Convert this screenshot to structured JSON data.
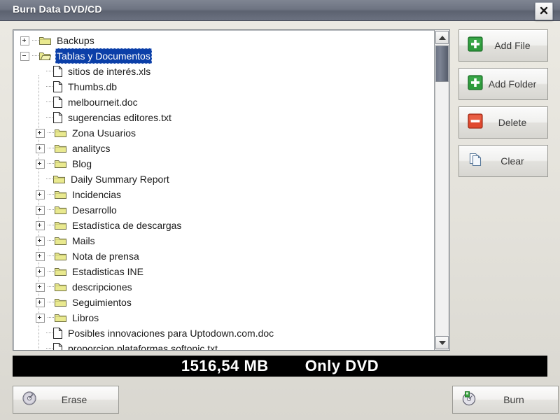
{
  "window": {
    "title": "Burn Data DVD/CD",
    "close_icon": "close-icon"
  },
  "tree": {
    "items": [
      {
        "label": "Backups",
        "type": "folder",
        "depth": 0,
        "toggle": "plus",
        "selected": false
      },
      {
        "label": "Tablas y Documentos",
        "type": "folder-open",
        "depth": 0,
        "toggle": "minus",
        "selected": true
      },
      {
        "label": "sitios de interés.xls",
        "type": "file",
        "depth": 1,
        "toggle": "none",
        "selected": false
      },
      {
        "label": "Thumbs.db",
        "type": "file",
        "depth": 1,
        "toggle": "none",
        "selected": false
      },
      {
        "label": "melbourneit.doc",
        "type": "file",
        "depth": 1,
        "toggle": "none",
        "selected": false
      },
      {
        "label": "sugerencias editores.txt",
        "type": "file",
        "depth": 1,
        "toggle": "none",
        "selected": false
      },
      {
        "label": "Zona Usuarios",
        "type": "folder",
        "depth": 1,
        "toggle": "plus",
        "selected": false
      },
      {
        "label": "analitycs",
        "type": "folder",
        "depth": 1,
        "toggle": "plus",
        "selected": false
      },
      {
        "label": "Blog",
        "type": "folder",
        "depth": 1,
        "toggle": "plus",
        "selected": false
      },
      {
        "label": "Daily Summary Report",
        "type": "folder",
        "depth": 1,
        "toggle": "none",
        "selected": false
      },
      {
        "label": "Incidencias",
        "type": "folder",
        "depth": 1,
        "toggle": "plus",
        "selected": false
      },
      {
        "label": "Desarrollo",
        "type": "folder",
        "depth": 1,
        "toggle": "plus",
        "selected": false
      },
      {
        "label": "Estadística de descargas",
        "type": "folder",
        "depth": 1,
        "toggle": "plus",
        "selected": false
      },
      {
        "label": "Mails",
        "type": "folder",
        "depth": 1,
        "toggle": "plus",
        "selected": false
      },
      {
        "label": "Nota de prensa",
        "type": "folder",
        "depth": 1,
        "toggle": "plus",
        "selected": false
      },
      {
        "label": "Estadisticas INE",
        "type": "folder",
        "depth": 1,
        "toggle": "plus",
        "selected": false
      },
      {
        "label": "descripciones",
        "type": "folder",
        "depth": 1,
        "toggle": "plus",
        "selected": false
      },
      {
        "label": "Seguimientos",
        "type": "folder",
        "depth": 1,
        "toggle": "plus",
        "selected": false
      },
      {
        "label": "Libros",
        "type": "folder",
        "depth": 1,
        "toggle": "plus",
        "selected": false
      },
      {
        "label": "Posibles innovaciones para Uptodown.com.doc",
        "type": "file",
        "depth": 1,
        "toggle": "none",
        "selected": false
      },
      {
        "label": "proporcion plataformas softonic.txt",
        "type": "file",
        "depth": 1,
        "toggle": "none",
        "selected": false
      }
    ]
  },
  "scrollbar": {
    "up_icon": "triangle-up-icon",
    "down_icon": "triangle-down-icon"
  },
  "side_buttons": [
    {
      "label": "Add File",
      "icon": "add-green-plus-icon",
      "name": "add-file-button"
    },
    {
      "label": "Add Folder",
      "icon": "add-green-plus-icon",
      "name": "add-folder-button"
    },
    {
      "label": "Delete",
      "icon": "delete-red-minus-icon",
      "name": "delete-button"
    },
    {
      "label": "Clear",
      "icon": "clear-pages-icon",
      "name": "clear-button"
    }
  ],
  "status": {
    "size": "1516,54 MB",
    "mode": "Only DVD"
  },
  "bottom_buttons": {
    "erase": {
      "label": "Erase",
      "icon": "erase-disc-icon"
    },
    "burn": {
      "label": "Burn",
      "icon": "burn-disc-icon"
    }
  },
  "colors": {
    "titlebar": "#6e7482",
    "selection": "#0b3fa8",
    "folder": "#e8e88c",
    "add_green": "#2e9b3c",
    "delete_red": "#e0492f",
    "status_bg": "#000000"
  }
}
